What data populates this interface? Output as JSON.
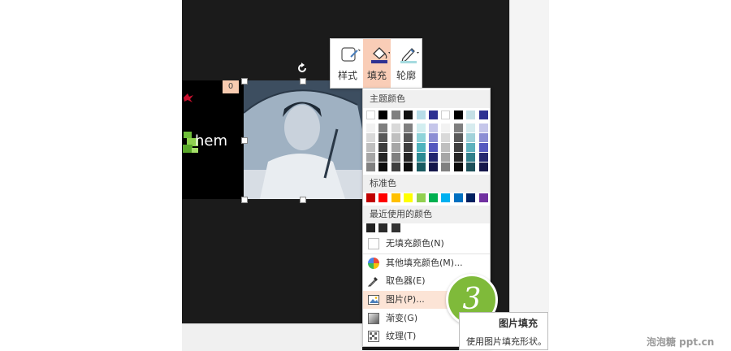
{
  "slide": {
    "text": "hem",
    "animation_badge": "0"
  },
  "mini_toolbar": {
    "style_label": "样式",
    "fill_label": "填充",
    "outline_label": "轮廓"
  },
  "fill_menu": {
    "theme_colors_header": "主题颜色",
    "theme_top_row": [
      "#ffffff",
      "#000000",
      "#7f7f7f",
      "#111111",
      "#b7dde8",
      "#2e3192",
      "#ffffff",
      "#000000",
      "#c5e0e6",
      "#2e3192"
    ],
    "theme_shades": [
      [
        "#f2f2f2",
        "#d9d9d9",
        "#bfbfbf",
        "#a6a6a6",
        "#808080"
      ],
      [
        "#7f7f7f",
        "#595959",
        "#3f3f3f",
        "#262626",
        "#0d0d0d"
      ],
      [
        "#d9d9d9",
        "#bfbfbf",
        "#a6a6a6",
        "#7f7f7f",
        "#3f3f3f"
      ],
      [
        "#808080",
        "#595959",
        "#404040",
        "#262626",
        "#0d0d0d"
      ],
      [
        "#d2eef0",
        "#8fd3d9",
        "#4fb3bd",
        "#2c8a93",
        "#1a5a60"
      ],
      [
        "#c5c6ea",
        "#8c8ed4",
        "#5558bf",
        "#23266f",
        "#15174a"
      ],
      [
        "#f2f2f2",
        "#d9d9d9",
        "#bfbfbf",
        "#a6a6a6",
        "#808080"
      ],
      [
        "#7f7f7f",
        "#595959",
        "#3f3f3f",
        "#262626",
        "#0d0d0d"
      ],
      [
        "#d7ecef",
        "#a2d2da",
        "#5fb1bd",
        "#327f8a",
        "#1e5059"
      ],
      [
        "#c5c6ea",
        "#8c8ed4",
        "#5558bf",
        "#23266f",
        "#15174a"
      ]
    ],
    "standard_colors_header": "标准色",
    "standard_colors": [
      "#c00000",
      "#ff0000",
      "#ffc000",
      "#ffff00",
      "#92d050",
      "#00b050",
      "#00b0f0",
      "#0070c0",
      "#002060",
      "#7030a0"
    ],
    "recent_colors_header": "最近使用的颜色",
    "recent_colors": [
      "#222222",
      "#2b2b2b",
      "#333333"
    ],
    "items": [
      {
        "label": "无填充颜色(N)"
      },
      {
        "label": "其他填充颜色(M)..."
      },
      {
        "label": "取色器(E)"
      },
      {
        "label": "图片(P)..."
      },
      {
        "label": "渐变(G)"
      },
      {
        "label": "纹理(T)"
      }
    ]
  },
  "step_badge": "3",
  "tooltip": {
    "title": "图片填充",
    "description": "使用图片填充形状。"
  },
  "watermark": "泡泡糖 ppt.cn"
}
